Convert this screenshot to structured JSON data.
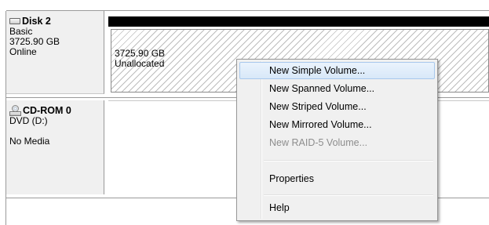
{
  "disk2": {
    "name": "Disk 2",
    "type": "Basic",
    "size": "3725.90 GB",
    "status": "Online",
    "volume": {
      "size": "3725.90 GB",
      "state": "Unallocated"
    }
  },
  "cdrom": {
    "name": "CD-ROM 0",
    "drive": "DVD (D:)",
    "media": "No Media"
  },
  "menu": {
    "items": [
      {
        "label": "New Simple Volume...",
        "enabled": true,
        "highlighted": true
      },
      {
        "label": "New Spanned Volume...",
        "enabled": true
      },
      {
        "label": "New Striped Volume...",
        "enabled": true
      },
      {
        "label": "New Mirrored Volume...",
        "enabled": true
      },
      {
        "label": "New RAID-5 Volume...",
        "enabled": false
      },
      {
        "label": "Properties",
        "enabled": true
      },
      {
        "label": "Help",
        "enabled": true
      }
    ]
  },
  "colors": {
    "menu_highlight": "#d8e8f8",
    "disk_bar": "#000000",
    "disabled_text": "#8d8d8d"
  },
  "icons": {
    "disk": "hard-disk-icon",
    "cdrom": "cd-rom-icon"
  }
}
